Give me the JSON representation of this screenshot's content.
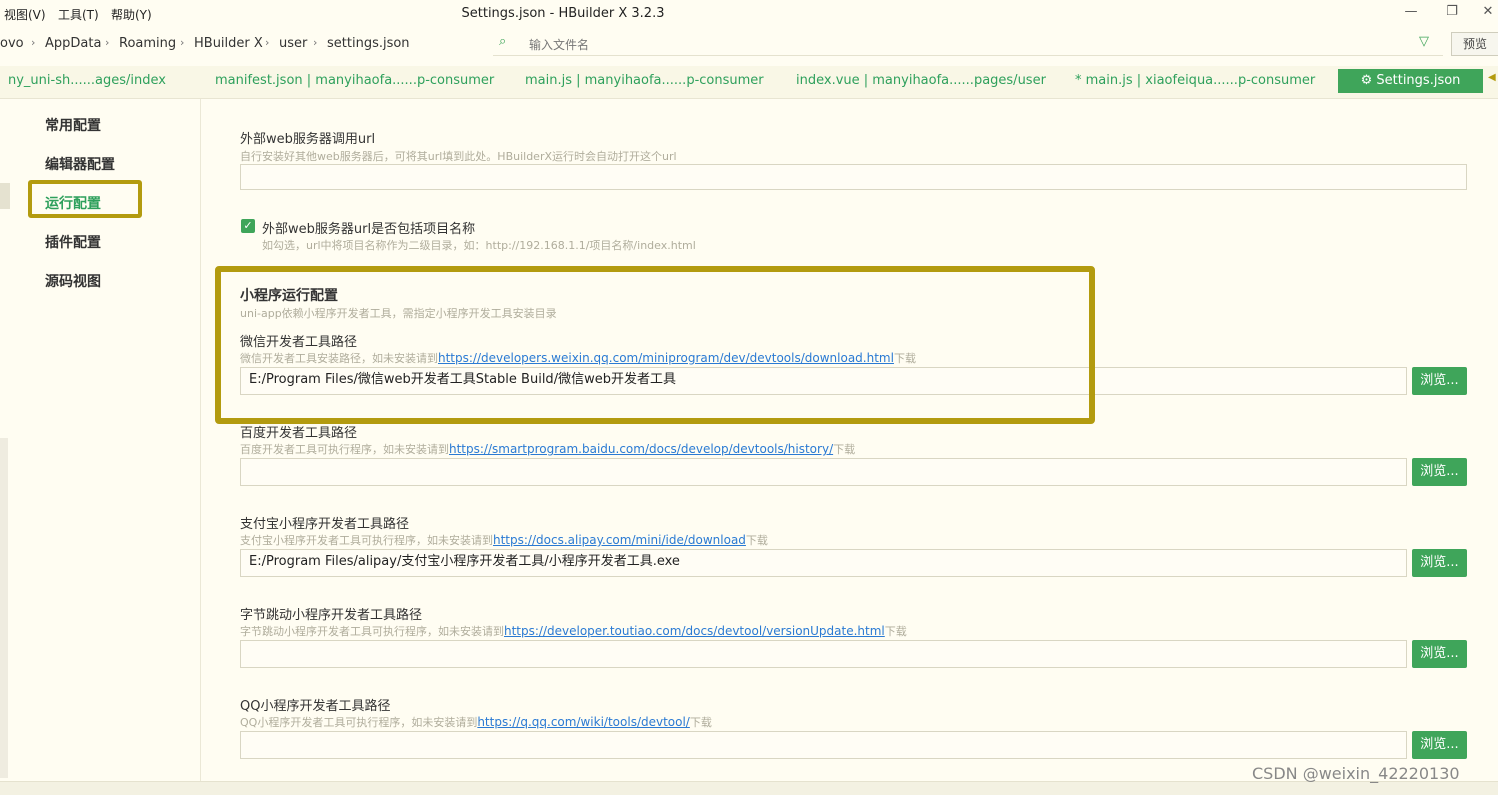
{
  "menu": {
    "view": "视图(V)",
    "tools": "工具(T)",
    "help": "帮助(Y)"
  },
  "window": {
    "title": "Settings.json - HBuilder X 3.2.3",
    "minimize_icon": "minimize-icon",
    "maximize_icon": "maximize-icon",
    "close_icon": "close-icon"
  },
  "breadcrumb": [
    "ovo",
    "AppData",
    "Roaming",
    "HBuilder X",
    "user",
    "settings.json"
  ],
  "search": {
    "placeholder": "输入文件名",
    "icon": "search-file-icon",
    "filter_icon": "filter-icon"
  },
  "preview": "预览",
  "tabs": [
    "ny_uni-sh......ages/index",
    "manifest.json | manyihaofa......p-consumer",
    "main.js | manyihaofa......p-consumer",
    "index.vue | manyihaofa......pages/user",
    "* main.js | xiaofeiqua......p-consumer"
  ],
  "active_tab": {
    "label": "Settings.json",
    "icon": "gear-icon"
  },
  "sidebar": [
    "常用配置",
    "编辑器配置",
    "运行配置",
    "插件配置",
    "源码视图"
  ],
  "content": {
    "web_url_label": "外部web服务器调用url",
    "web_url_hint": "自行安装好其他web服务器后，可将其url填到此处。HBuilderX运行时会自动打开这个url",
    "web_url_value": "",
    "include_project_label": "外部web服务器url是否包括项目名称",
    "include_project_hint": "如勾选，url中将项目名称作为二级目录，如：http://192.168.1.1/项目名称/index.html",
    "include_project_checked": true,
    "mp_section_title": "小程序运行配置",
    "mp_section_hint": "uni-app依赖小程序开发者工具，需指定小程序开发工具安装目录",
    "wechat": {
      "label": "微信开发者工具路径",
      "hint_pre": "微信开发者工具安装路径，如未安装请到",
      "link": "https://developers.weixin.qq.com/miniprogram/dev/devtools/download.html",
      "hint_post": "下载",
      "value": "E:/Program Files/微信web开发者工具Stable Build/微信web开发者工具"
    },
    "baidu": {
      "label": "百度开发者工具路径",
      "hint_pre": "百度开发者工具可执行程序，如未安装请到",
      "link": "https://smartprogram.baidu.com/docs/develop/devtools/history/",
      "hint_post": "下载",
      "value": ""
    },
    "alipay": {
      "label": "支付宝小程序开发者工具路径",
      "hint_pre": "支付宝小程序开发者工具可执行程序，如未安装请到",
      "link": "https://docs.alipay.com/mini/ide/download",
      "hint_post": "下载",
      "value": "E:/Program Files/alipay/支付宝小程序开发者工具/小程序开发者工具.exe"
    },
    "toutiao": {
      "label": "字节跳动小程序开发者工具路径",
      "hint_pre": "字节跳动小程序开发者工具可执行程序，如未安装请到",
      "link": "https://developer.toutiao.com/docs/devtool/versionUpdate.html",
      "hint_post": "下载",
      "value": ""
    },
    "qq": {
      "label": "QQ小程序开发者工具路径",
      "hint_pre": "QQ小程序开发者工具可执行程序，如未安装请到",
      "link": "https://q.qq.com/wiki/tools/devtool/",
      "hint_post": "下载",
      "value": ""
    },
    "browse_label": "浏览..."
  },
  "watermark": "CSDN @weixin_42220130"
}
